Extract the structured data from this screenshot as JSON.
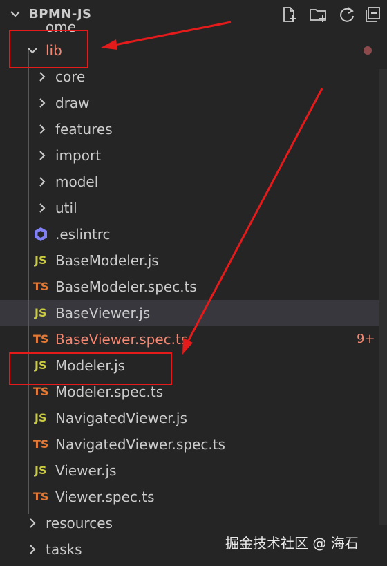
{
  "explorer": {
    "title": "BPMN-JS",
    "actions": [
      "new-file-icon",
      "new-folder-icon",
      "refresh-icon",
      "collapse-all-icon"
    ]
  },
  "tree": {
    "partial_top": "ome",
    "lib": "lib",
    "folders": [
      "core",
      "draw",
      "features",
      "import",
      "model",
      "util"
    ],
    "eslintrc": ".eslintrc",
    "files": [
      {
        "badge": "JS",
        "name": "BaseModeler.js"
      },
      {
        "badge": "TS",
        "name": "BaseModeler.spec.ts"
      },
      {
        "badge": "JS",
        "name": "BaseViewer.js"
      },
      {
        "badge": "TS",
        "name": "BaseViewer.spec.ts",
        "count": "9+"
      },
      {
        "badge": "JS",
        "name": "Modeler.js"
      },
      {
        "badge": "TS",
        "name": "Modeler.spec.ts"
      },
      {
        "badge": "JS",
        "name": "NavigatedViewer.js"
      },
      {
        "badge": "TS",
        "name": "NavigatedViewer.spec.ts"
      },
      {
        "badge": "JS",
        "name": "Viewer.js"
      },
      {
        "badge": "TS",
        "name": "Viewer.spec.ts"
      }
    ],
    "bottom_folders": [
      "resources",
      "tasks"
    ]
  },
  "watermark": "掘金技术社区 @ 海石",
  "colors": {
    "background": "#252526",
    "selected": "#37373d",
    "error_text": "#f48771",
    "js_badge": "#cbcb41",
    "ts_badge": "#e37933",
    "annotation_red": "#e51b1b"
  }
}
